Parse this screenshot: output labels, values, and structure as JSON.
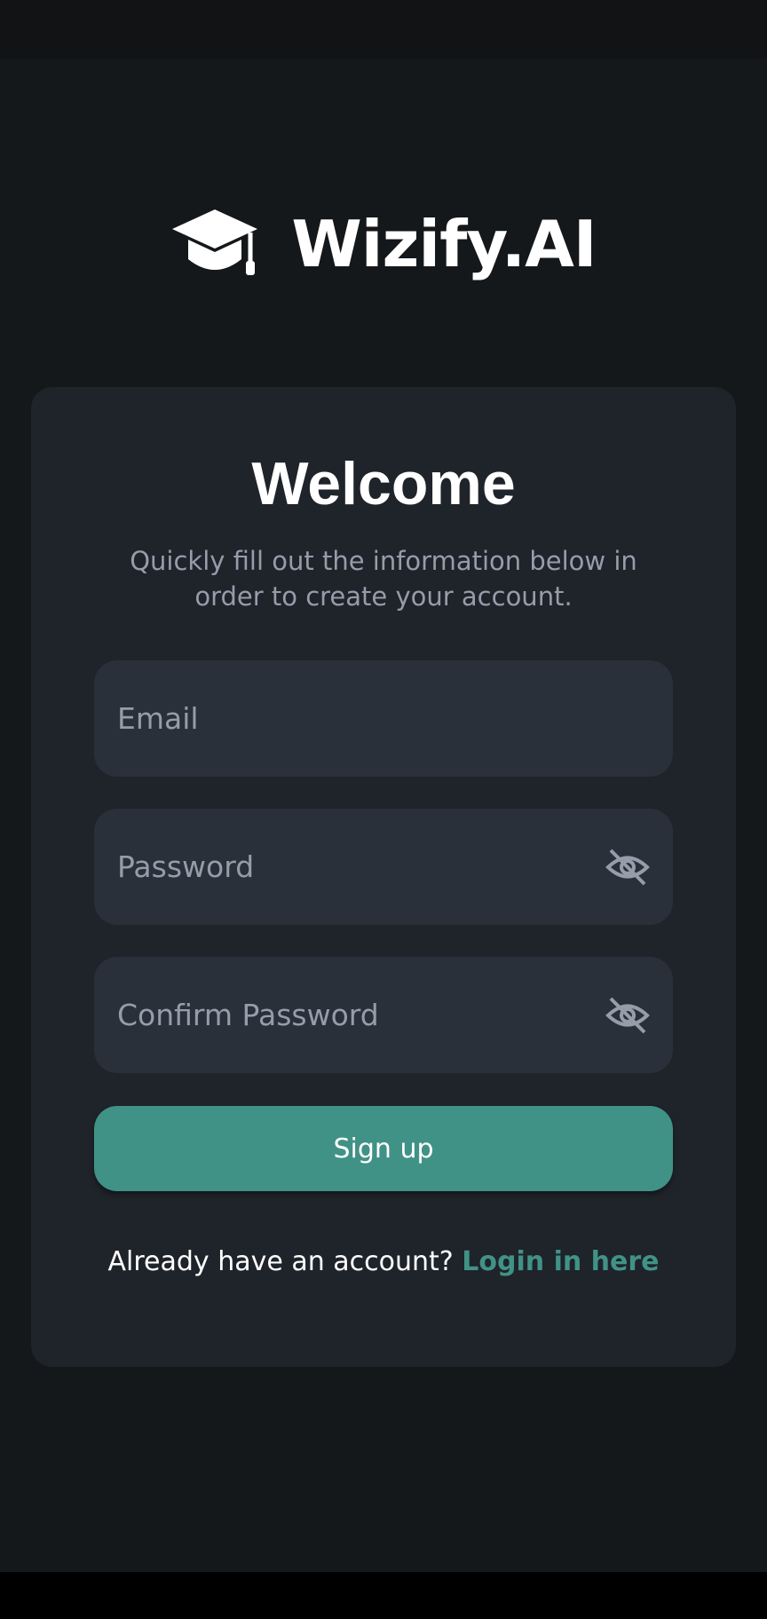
{
  "brand": {
    "name": "Wizify.AI",
    "icon": "graduation-cap-icon"
  },
  "card": {
    "title": "Welcome",
    "subtitle": "Quickly fill out the information below in order to create your account."
  },
  "form": {
    "email": {
      "placeholder": "Email",
      "value": ""
    },
    "password": {
      "placeholder": "Password",
      "value": "",
      "toggle_icon": "eye-off-icon"
    },
    "confirm_password": {
      "placeholder": "Confirm Password",
      "value": "",
      "toggle_icon": "eye-off-icon"
    },
    "submit_label": "Sign up"
  },
  "footer": {
    "prompt": "Already have an account?",
    "link_label": "Login in here"
  },
  "colors": {
    "background": "#14181b",
    "card": "#1f232a",
    "field": "#2a3039",
    "accent": "#419286",
    "muted_text": "#959dab"
  }
}
